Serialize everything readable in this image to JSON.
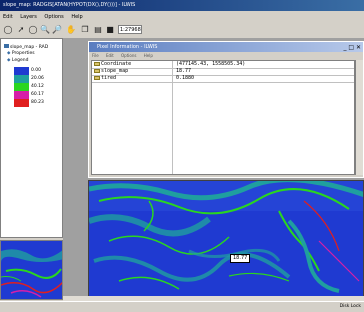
{
  "window": {
    "title": "slope_map: RADGIS[ATAN(HYPOT(DX(),DY()))] - ILWIS"
  },
  "menu": [
    "Edit",
    "Layers",
    "Options",
    "Help"
  ],
  "toolbar": {
    "coordinate_value": "1:27968"
  },
  "toc": {
    "map_name": "slope_map - RAD",
    "properties_label": "Properties",
    "legend_label": "Legend",
    "legend": [
      {
        "label": "0.00",
        "color": "#1f3ad1"
      },
      {
        "label": "20.06",
        "color": "#1f9f9f"
      },
      {
        "label": "40.12",
        "color": "#2ad61f"
      },
      {
        "label": "60.17",
        "color": "#d61fa8"
      },
      {
        "label": "80.23",
        "color": "#e01f1f"
      }
    ]
  },
  "pixel_info": {
    "title": "Pixel Information - ILWIS",
    "menu": [
      "File",
      "Edit",
      "Options",
      "Help"
    ],
    "rows": [
      {
        "key": "Coordinate",
        "value": "(477145.43, 1558505.34)"
      },
      {
        "key": "slope_map",
        "value": "18.77"
      },
      {
        "key": "tired",
        "value": "0.1880"
      }
    ]
  },
  "map": {
    "tooltip": "18.77"
  },
  "status": {
    "right_text": "Disk Lock"
  },
  "colors": {
    "title_active": "#0a246a",
    "title_inactive": "#5a7dc0",
    "map_base": "#1f3ad1"
  }
}
